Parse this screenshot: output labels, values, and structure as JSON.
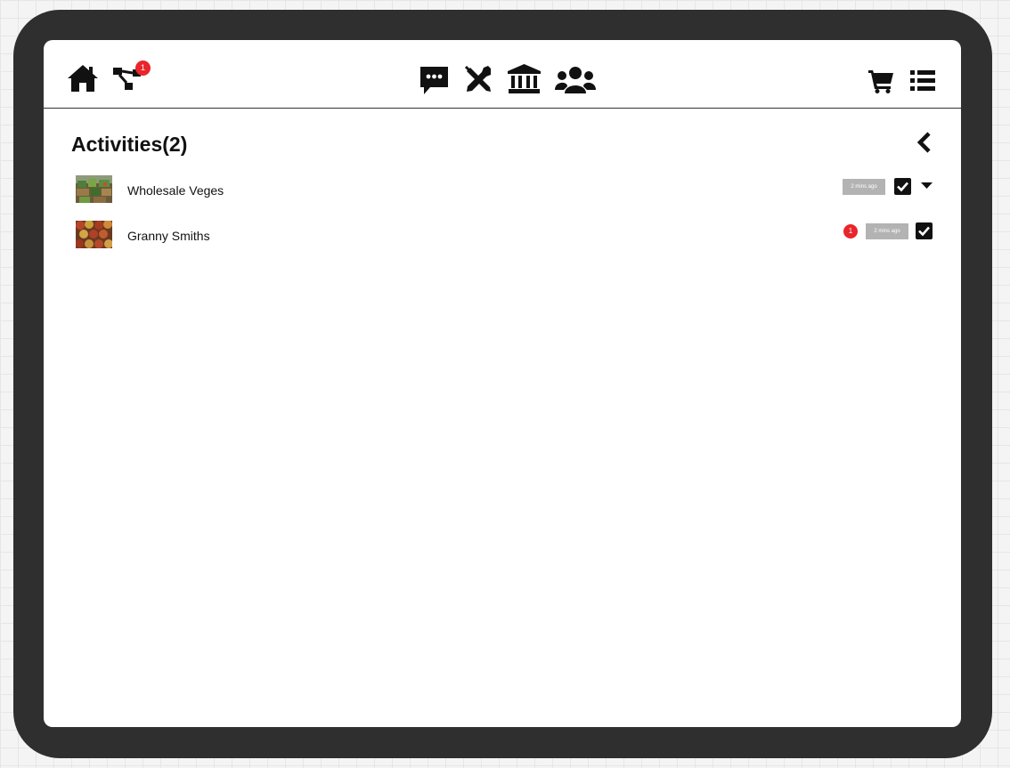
{
  "nav": {
    "home_icon": "home-icon",
    "hierarchy_icon": "sitemap-icon",
    "hierarchy_badge": "1",
    "chat_icon": "chat-icon",
    "tools_icon": "tools-icon",
    "bank_icon": "bank-icon",
    "people_icon": "people-icon",
    "cart_icon": "cart-icon",
    "menu_icon": "list-icon"
  },
  "page": {
    "title": "Activities(2)",
    "back_icon": "chevron-left-icon"
  },
  "activities": [
    {
      "name": "Wholesale Veges",
      "time": "2 mins ago",
      "checked": true,
      "badge": null,
      "expand_icon": "caret-down-icon"
    },
    {
      "name": "Granny Smiths",
      "time": "2 mins ago",
      "checked": true,
      "badge": "1"
    }
  ],
  "colors": {
    "device_frame": "#2f2f2f",
    "badge": "#e8262b",
    "timestamp_bg": "#b3b3b3",
    "icon": "#111111"
  }
}
